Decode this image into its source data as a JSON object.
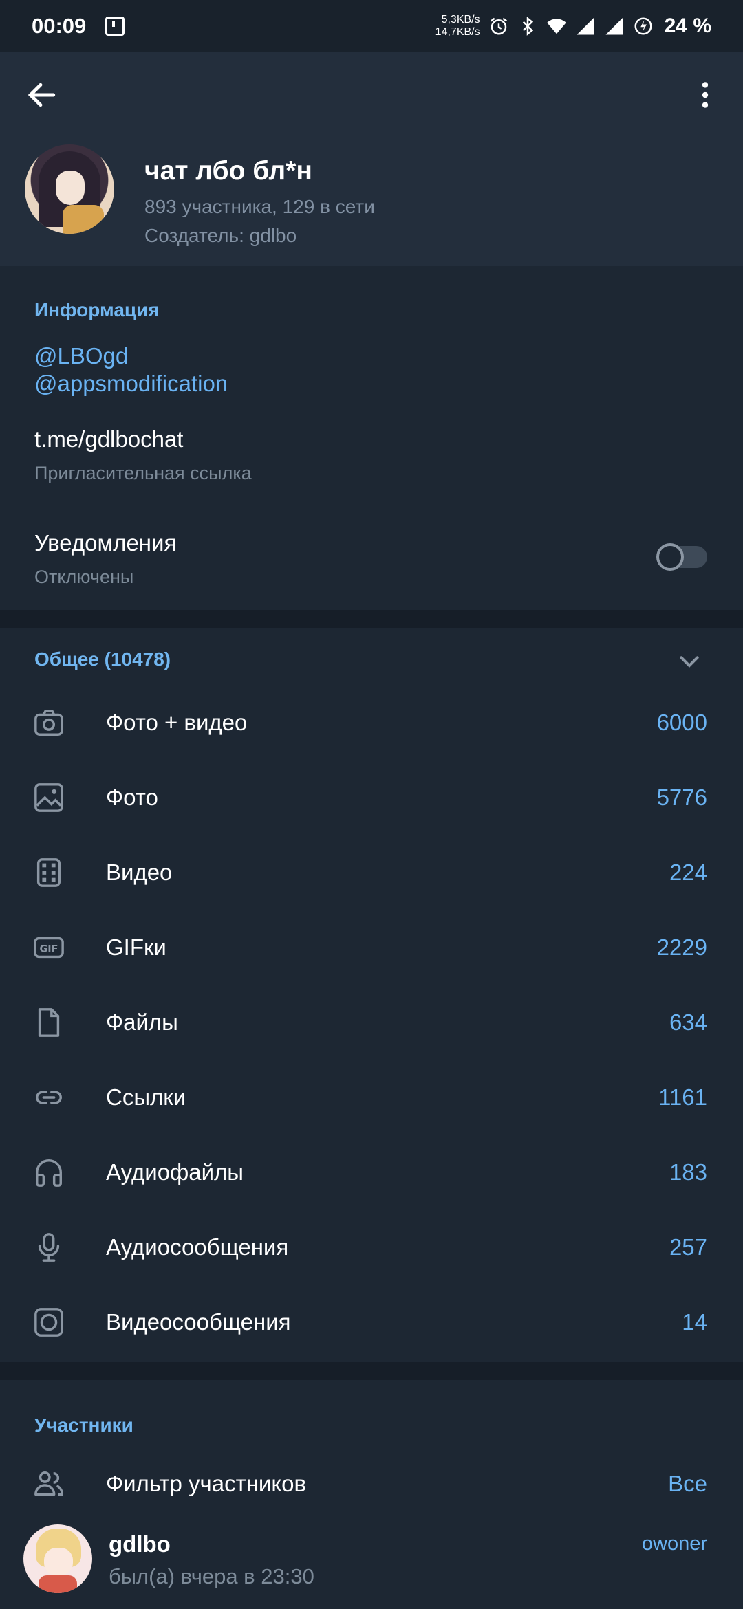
{
  "status_bar": {
    "time": "00:09",
    "speed_up": "5,3KB/s",
    "speed_down": "14,7KB/s",
    "battery": "24 %"
  },
  "header": {
    "title": "чат лбо бл*н",
    "subtitle": "893 участника, 129 в сети",
    "creator": "Создатель: gdlbo"
  },
  "info": {
    "section_title": "Информация",
    "links": [
      "@LBOgd",
      "@appsmodification"
    ],
    "invite_link": "t.me/gdlbochat",
    "invite_label": "Пригласительная ссылка",
    "notifications_label": "Уведомления",
    "notifications_state": "Отключены",
    "notifications_enabled": false
  },
  "media": {
    "section_title": "Общее (10478)",
    "items": [
      {
        "label": "Фото + видео",
        "count": "6000",
        "icon": "camera-icon"
      },
      {
        "label": "Фото",
        "count": "5776",
        "icon": "image-icon"
      },
      {
        "label": "Видео",
        "count": "224",
        "icon": "film-icon"
      },
      {
        "label": "GIFки",
        "count": "2229",
        "icon": "gif-icon"
      },
      {
        "label": "Файлы",
        "count": "634",
        "icon": "file-icon"
      },
      {
        "label": "Ссылки",
        "count": "1161",
        "icon": "link-icon"
      },
      {
        "label": "Аудиофайлы",
        "count": "183",
        "icon": "headphones-icon"
      },
      {
        "label": "Аудиосообщения",
        "count": "257",
        "icon": "microphone-icon"
      },
      {
        "label": "Видеосообщения",
        "count": "14",
        "icon": "video-message-icon"
      }
    ]
  },
  "members": {
    "section_title": "Участники",
    "filter_label": "Фильтр участников",
    "filter_value": "Все",
    "list": [
      {
        "name": "gdlbo",
        "status": "был(а) вчера в 23:30",
        "role": "owoner"
      }
    ]
  }
}
